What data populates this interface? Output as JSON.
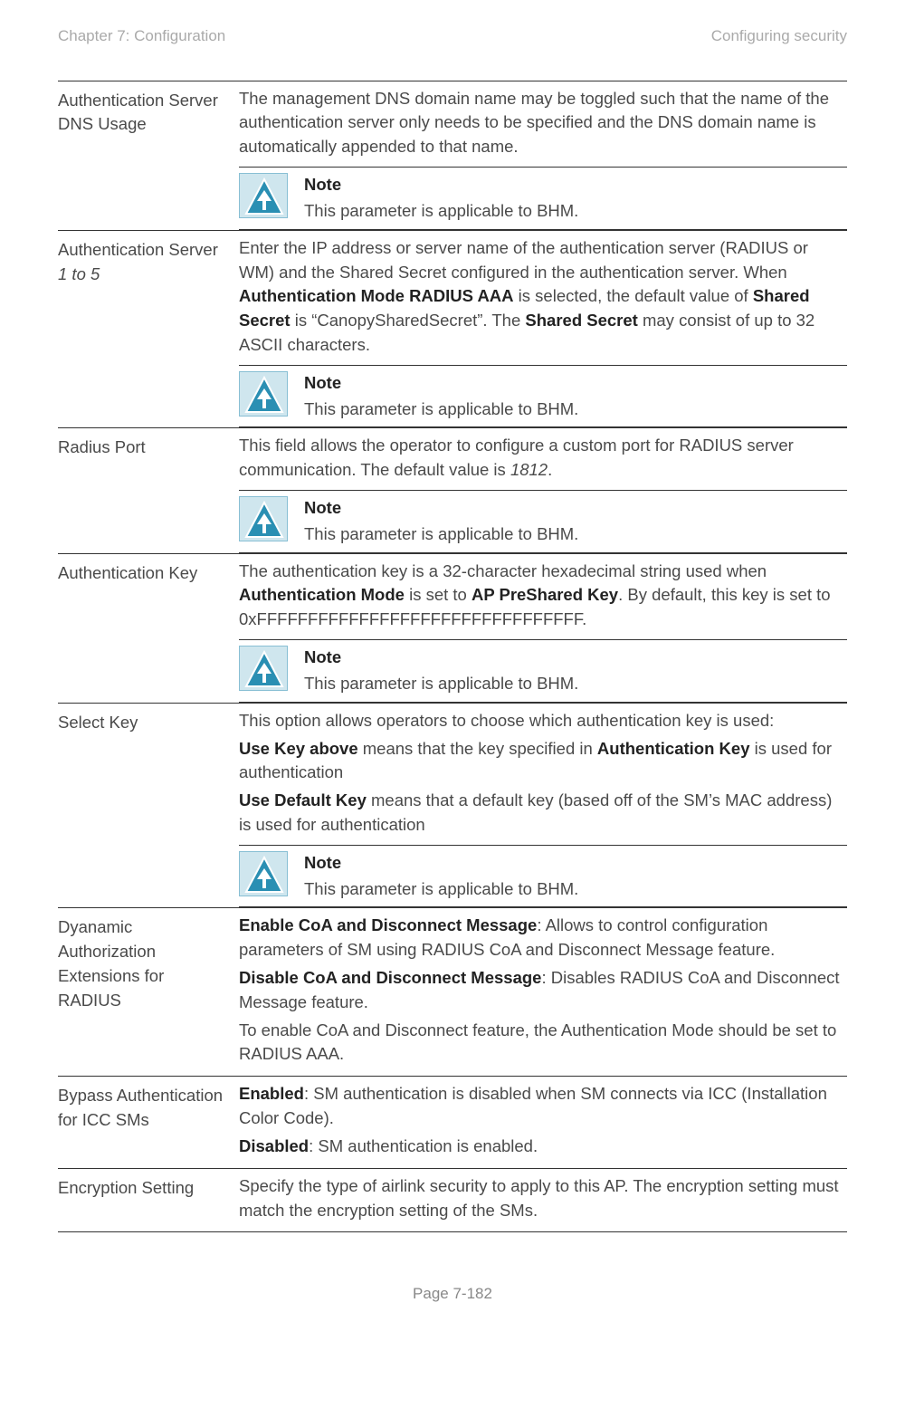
{
  "header": {
    "left": "Chapter 7:  Configuration",
    "right": "Configuring security"
  },
  "footer": "Page 7-182",
  "note_label": "Note",
  "note_body": "This parameter is applicable to BHM.",
  "rows": {
    "r1": {
      "term": "Authentication Server DNS Usage",
      "p1": "The management DNS domain name may be toggled such that the name of the authentication server only needs to be specified and the DNS domain name is automatically appended to that name."
    },
    "r2": {
      "term_a": "Authentication Server ",
      "term_b": "1 to 5",
      "p1a": "Enter the IP address or server name of the authentication server (RADIUS or WM) and the Shared Secret configured in the authentication server. When ",
      "b1": "Authentication Mode RADIUS AAA",
      "p1b": " is selected, the default value of ",
      "b2": "Shared Secret",
      "p1c": " is “CanopySharedSecret”. The ",
      "b3": "Shared Secret",
      "p1d": " may consist of up to 32 ASCII characters."
    },
    "r3": {
      "term": "Radius Port",
      "p1a": "This field allows the operator to configure a custom port for RADIUS server communication. The default value is ",
      "i1": "1812",
      "p1b": "."
    },
    "r4": {
      "term": "Authentication Key",
      "p1a": "The authentication key is a 32-character hexadecimal string used when ",
      "b1": "Authentication Mode",
      "p1b": " is set to ",
      "b2": "AP PreShared Key",
      "p1c": ". By default, this key is set to 0xFFFFFFFFFFFFFFFFFFFFFFFFFFFFFFFF."
    },
    "r5": {
      "term": "Select Key",
      "p1": "This option allows operators to choose which authentication key is used:",
      "b1": "Use Key above",
      "p2a": " means that the key specified in ",
      "b2": "Authentication Key",
      "p2b": " is used for authentication",
      "b3": "Use Default Key",
      "p3": " means that a default key (based off of the SM’s MAC address) is used for authentication"
    },
    "r6": {
      "term": "Dyanamic Authorization Extensions for RADIUS",
      "b1": "Enable CoA and Disconnect Message",
      "p1": ": Allows to control configuration parameters of SM using RADIUS CoA and Disconnect Message feature.",
      "b2": "Disable CoA and Disconnect Message",
      "p2": ": Disables RADIUS CoA and Disconnect Message feature.",
      "p3": "To enable CoA and Disconnect feature, the Authentication Mode should be set to RADIUS AAA."
    },
    "r7": {
      "term": "Bypass Authentication for ICC SMs",
      "b1": "Enabled",
      "p1": ": SM authentication is disabled when SM connects via ICC (Installation Color Code).",
      "b2": "Disabled",
      "p2": ": SM authentication is enabled."
    },
    "r8": {
      "term": "Encryption Setting",
      "p1": "Specify the type of airlink security to apply to this AP. The encryption setting must match the encryption setting of the SMs."
    }
  }
}
